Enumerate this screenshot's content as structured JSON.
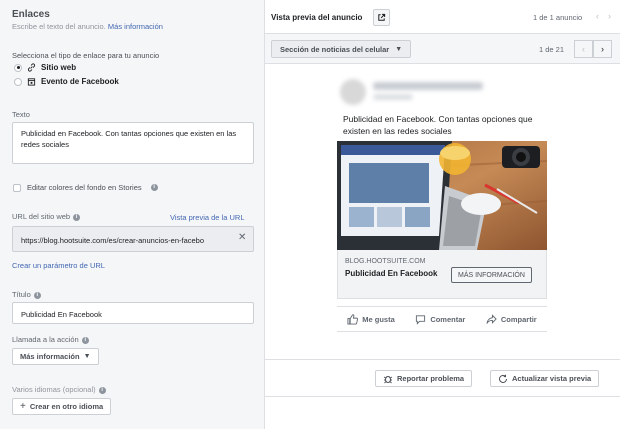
{
  "links": {
    "title": "Enlaces",
    "subtitle": "Escribe el texto del anuncio.",
    "more_info": "Más información",
    "link_type_label": "Selecciona el tipo de enlace para tu anuncio",
    "option_website": "Sitio web",
    "option_fb_event": "Evento de Facebook",
    "text_label": "Texto",
    "text_value": "Publicidad en Facebook. Con tantas opciones que existen en las redes sociales",
    "stories_checkbox": "Editar colores del fondo en Stories",
    "url_label": "URL del sitio web",
    "url_preview_link": "Vista previa de la URL",
    "url_value": "https://blog.hootsuite.com/es/crear-anuncios-en-facebo",
    "create_param": "Crear un parámetro de URL",
    "headline_label": "Título",
    "headline_value": "Publicidad En Facebook",
    "cta_label": "Llamada a la acción",
    "cta_value": "Más información",
    "languages_label": "Varios idiomas (opcional)",
    "create_language": "Crear en otro idioma"
  },
  "preview": {
    "title": "Vista previa del anuncio",
    "ad_count": "1 de 1 anuncio",
    "placement": "Sección de noticias del celular",
    "placement_count": "1 de 21",
    "post_text": "Publicidad en Facebook. Con tantas opciones que existen en las redes sociales",
    "domain": "BLOG.HOOTSUITE.COM",
    "headline": "Publicidad En Facebook",
    "cta": "MÁS INFORMACIÓN",
    "like": "Me gusta",
    "comment": "Comentar",
    "share": "Compartir",
    "report": "Reportar problema",
    "refresh": "Actualizar vista previa"
  },
  "colors": {
    "accent": "#4267b2",
    "panel_bg": "#f5f6f7",
    "border": "#dddfe2"
  }
}
